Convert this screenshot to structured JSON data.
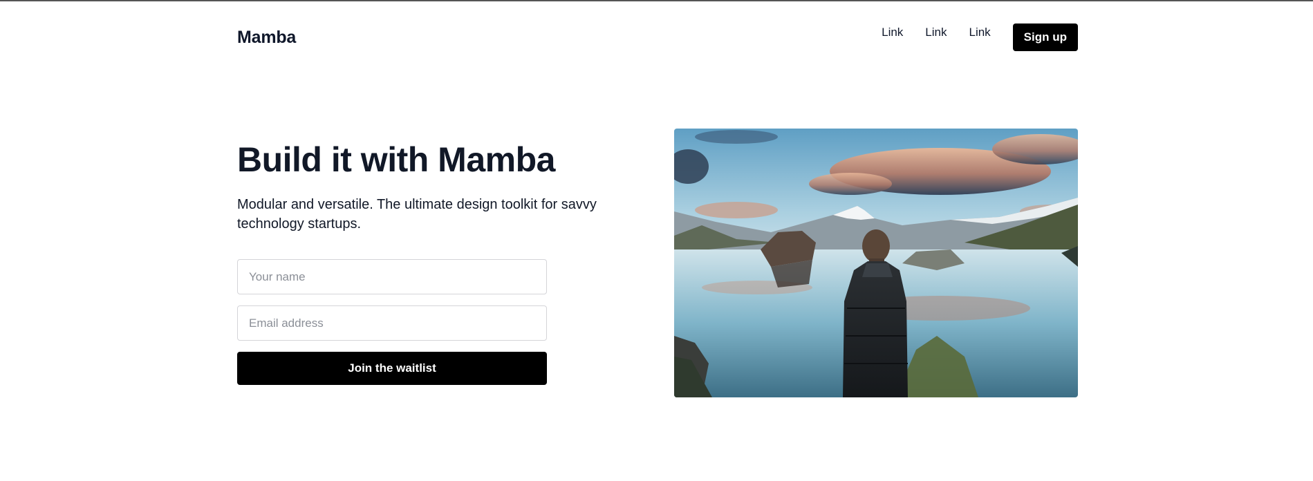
{
  "nav": {
    "logo": "Mamba",
    "links": [
      "Link",
      "Link",
      "Link"
    ],
    "signup_label": "Sign up"
  },
  "hero": {
    "title": "Build it with Mamba",
    "subtitle": "Modular and versatile. The ultimate design toolkit for savvy technology startups."
  },
  "form": {
    "name_placeholder": "Your name",
    "name_value": "",
    "email_placeholder": "Email address",
    "email_value": "",
    "submit_label": "Join the waitlist"
  },
  "image": {
    "subject": "person-at-mountain-lake-photo"
  },
  "colors": {
    "primary": "#000000",
    "text": "#111827",
    "border": "#d4d4d8",
    "placeholder": "#8b8f97",
    "background": "#ffffff"
  }
}
